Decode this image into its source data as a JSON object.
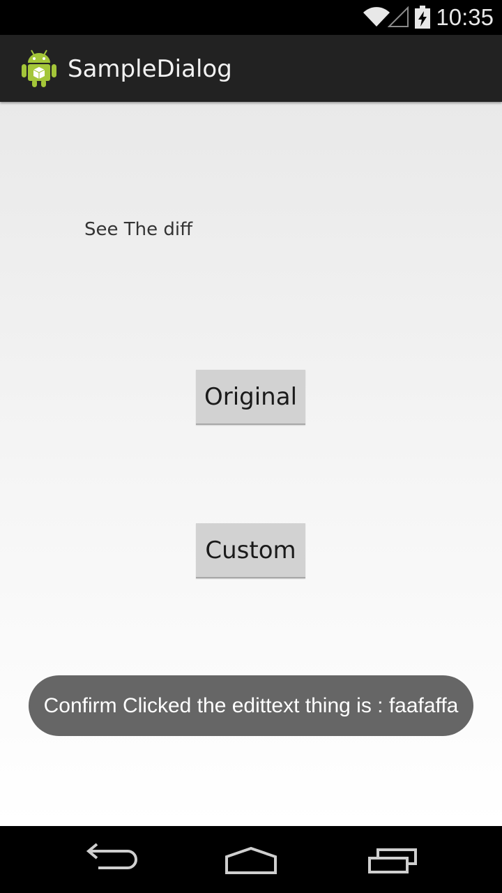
{
  "status_bar": {
    "time": "10:35",
    "icons": [
      "wifi-icon",
      "cell-signal-icon",
      "battery-charging-icon"
    ]
  },
  "action_bar": {
    "app_icon": "android-icon",
    "title": "SampleDialog"
  },
  "main": {
    "hint_text": "See The diff",
    "buttons": {
      "original_label": "Original",
      "custom_label": "Custom"
    }
  },
  "toast": {
    "message": "Confirm Clicked the edittext thing is : faafaffa"
  },
  "nav_bar": {
    "icons": [
      "back-icon",
      "home-icon",
      "recents-icon"
    ]
  },
  "colors": {
    "action_bar": "#222222",
    "button": "#d2d2d2",
    "toast": "#666666",
    "android_green": "#a4c639"
  }
}
